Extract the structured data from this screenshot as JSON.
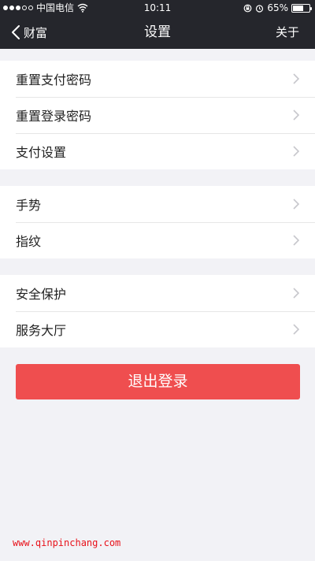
{
  "status_bar": {
    "carrier": "中国电信",
    "time": "10:11",
    "battery_text": "65%",
    "battery_level": 0.65,
    "signal_bars_filled": 3,
    "signal_bars_total": 5
  },
  "nav": {
    "back_label": "财富",
    "title": "设置",
    "right_label": "关于"
  },
  "groups": [
    {
      "items": [
        {
          "label": "重置支付密码"
        },
        {
          "label": "重置登录密码"
        },
        {
          "label": "支付设置"
        }
      ]
    },
    {
      "items": [
        {
          "label": "手势"
        },
        {
          "label": "指纹"
        }
      ]
    },
    {
      "items": [
        {
          "label": "安全保护"
        },
        {
          "label": "服务大厅"
        }
      ]
    }
  ],
  "logout": {
    "label": "退出登录"
  },
  "watermark": "www.qinpinchang.com",
  "colors": {
    "nav_background": "#25262c",
    "page_background": "#f2f2f6",
    "logout_red": "#ef4e4f",
    "watermark_red": "#e8111a"
  }
}
